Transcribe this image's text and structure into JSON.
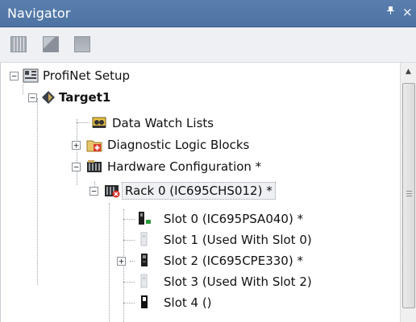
{
  "panel": {
    "title": "Navigator",
    "pin_glyph": "ꟷ",
    "close_glyph": "×"
  },
  "toolbar": {
    "buttons": [
      {
        "icon": "grid-view-icon"
      },
      {
        "icon": "chart-view-icon"
      },
      {
        "icon": "blank-view-icon"
      }
    ]
  },
  "tree": {
    "items": [
      {
        "label": "ProfiNet Setup",
        "icon": "profinet-icon",
        "expander": "−"
      },
      {
        "label": "Target1",
        "icon": "target-diamond-icon",
        "expander": "−"
      },
      {
        "label": "Data Watch Lists",
        "icon": "data-watch-icon"
      },
      {
        "label": "Diagnostic Logic Blocks",
        "icon": "diagnostic-folder-icon",
        "expander": "+"
      },
      {
        "label": "Hardware Configuration *",
        "icon": "hardware-config-icon",
        "expander": "−"
      },
      {
        "label": "Rack 0 (IC695CHS012) *",
        "icon": "rack-error-icon",
        "expander": "−"
      },
      {
        "label": "Slot 0 (IC695PSA040) *",
        "icon": "power-supply-icon"
      },
      {
        "label": "Slot 1 (Used With Slot 0)",
        "icon": "empty-slot-icon"
      },
      {
        "label": "Slot 2 (IC695CPE330) *",
        "icon": "cpu-module-icon",
        "expander": "+"
      },
      {
        "label": "Slot 3 (Used With Slot 2)",
        "icon": "empty-slot-icon"
      },
      {
        "label": "Slot 4 ()",
        "icon": "module-slot-icon"
      }
    ]
  },
  "colors": {
    "titlebar": "#5077a8",
    "toolbar": "#eef0f4",
    "selection": "#eef0f3"
  }
}
